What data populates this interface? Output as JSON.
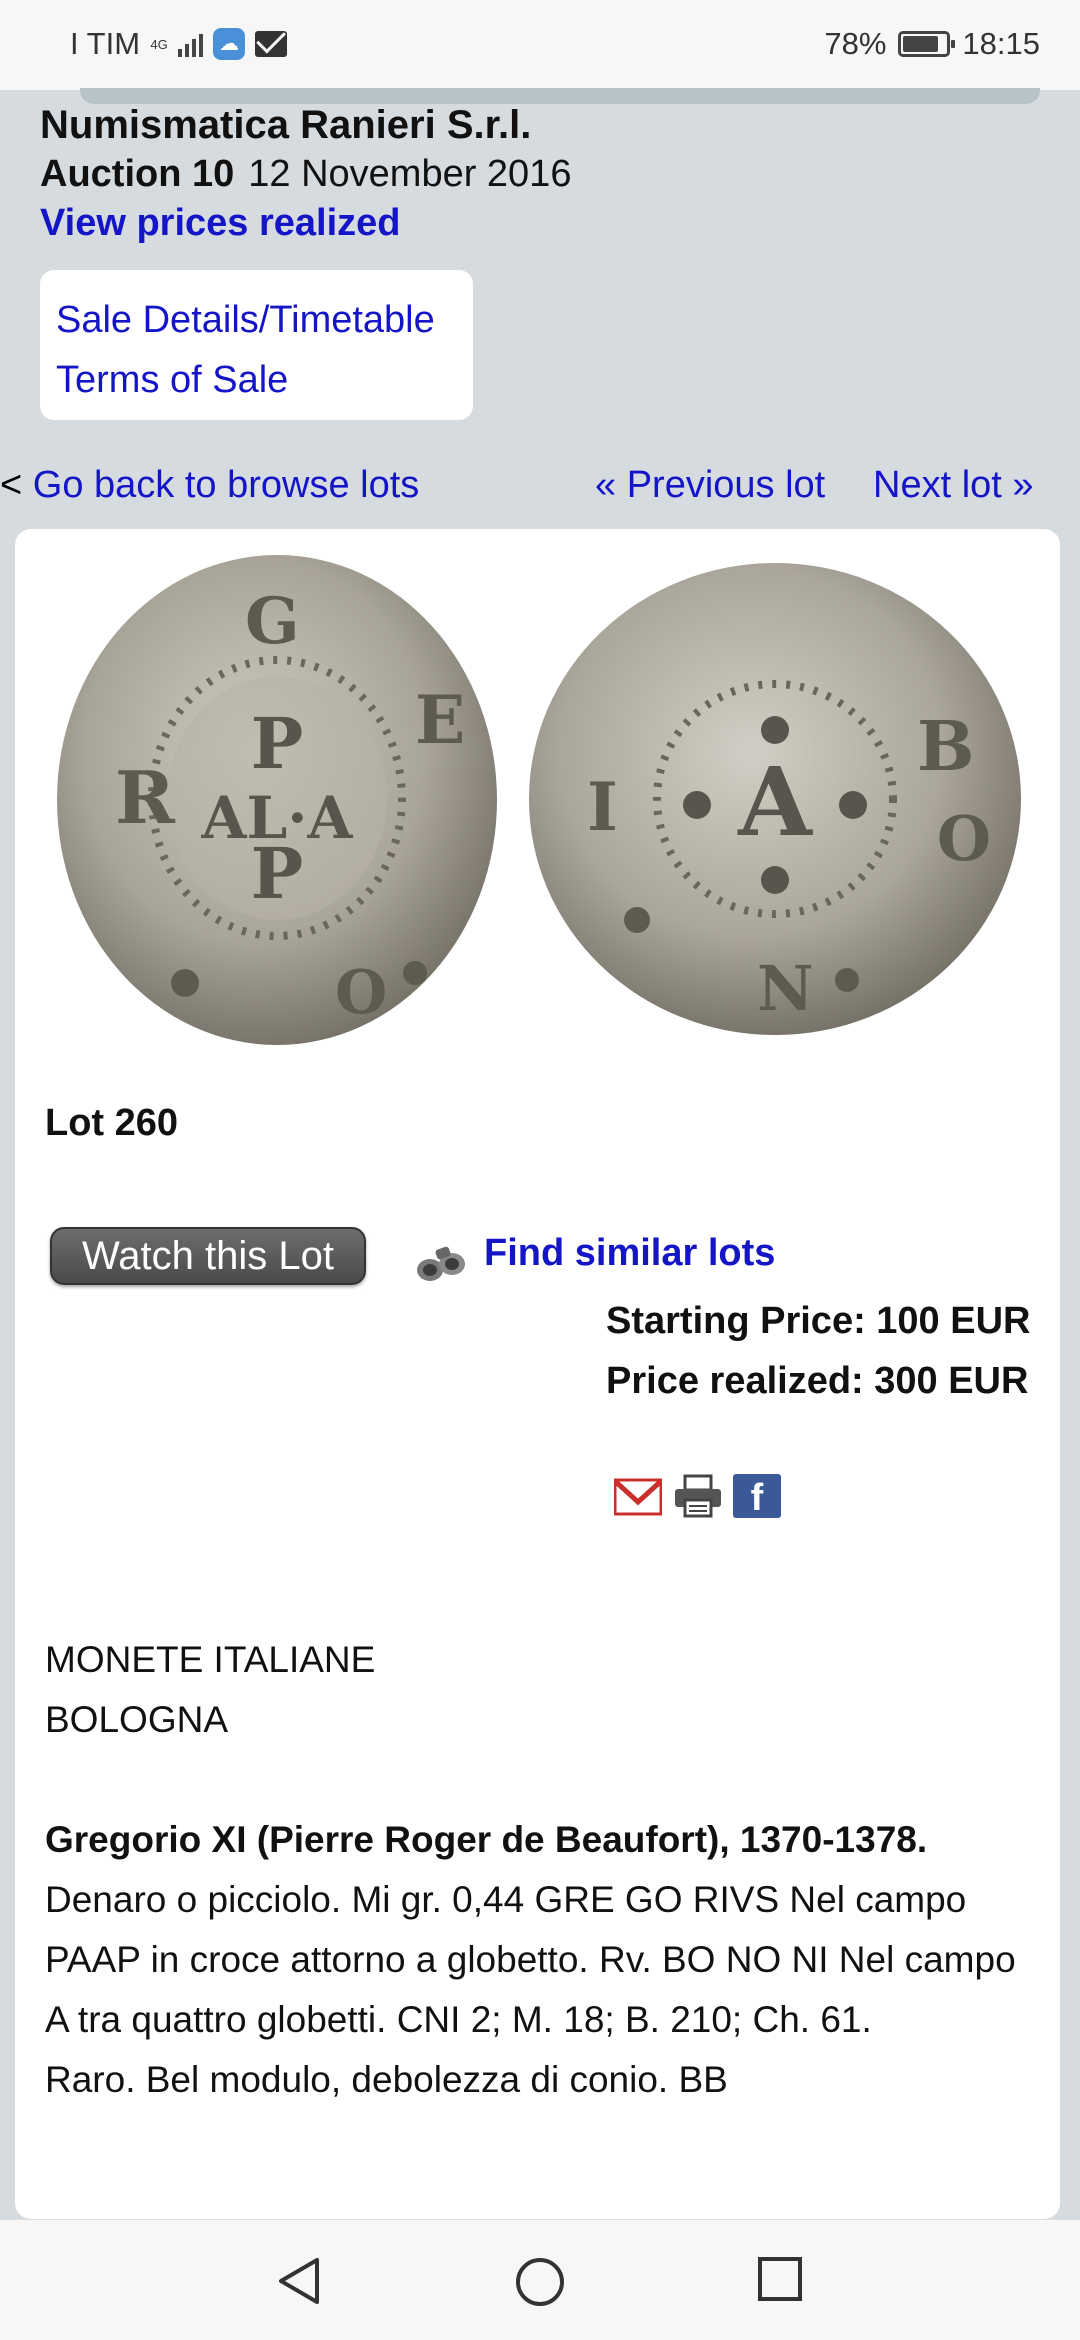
{
  "status_bar": {
    "carrier": "I TIM",
    "network": "4G",
    "battery": "78%",
    "time": "18:15",
    "battery_level": 0.78
  },
  "header": {
    "house": "Numismatica Ranieri S.r.l.",
    "auction_label": "Auction 10",
    "auction_date": "12 November 2016",
    "prices_link": "View prices realized"
  },
  "sale_links": [
    "Sale Details/Timetable",
    "Terms of Sale"
  ],
  "nav": {
    "back_prefix": "<",
    "back": "Go back to browse lots",
    "prev": "« Previous lot",
    "next": "Next lot »"
  },
  "lot": {
    "number": "Lot 260",
    "watch": "Watch this Lot",
    "find_similar": "Find similar lots",
    "starting_price": "Starting Price: 100 EUR",
    "price_realized": "Price realized: 300 EUR",
    "share_icons": [
      "gmail-icon",
      "print-icon",
      "facebook-icon"
    ]
  },
  "description": {
    "category": "MONETE ITALIANE",
    "city": "BOLOGNA",
    "ruler": "Gregorio XI (Pierre Roger de Beaufort), 1370-1378.",
    "text": "Denaro o picciolo. Mi gr. 0,44 GRE GO RIVS Nel campo PAAP in croce attorno a globetto. Rv. BO NO NI Nel campo A tra quattro globetti. CNI 2; M. 18; B. 210; Ch. 61.",
    "grade": "Raro. Bel modulo, debolezza di conio. BB"
  },
  "colors": {
    "link": "#1515c8",
    "page_bg": "#d5dbde",
    "facebook": "#3b5998"
  }
}
